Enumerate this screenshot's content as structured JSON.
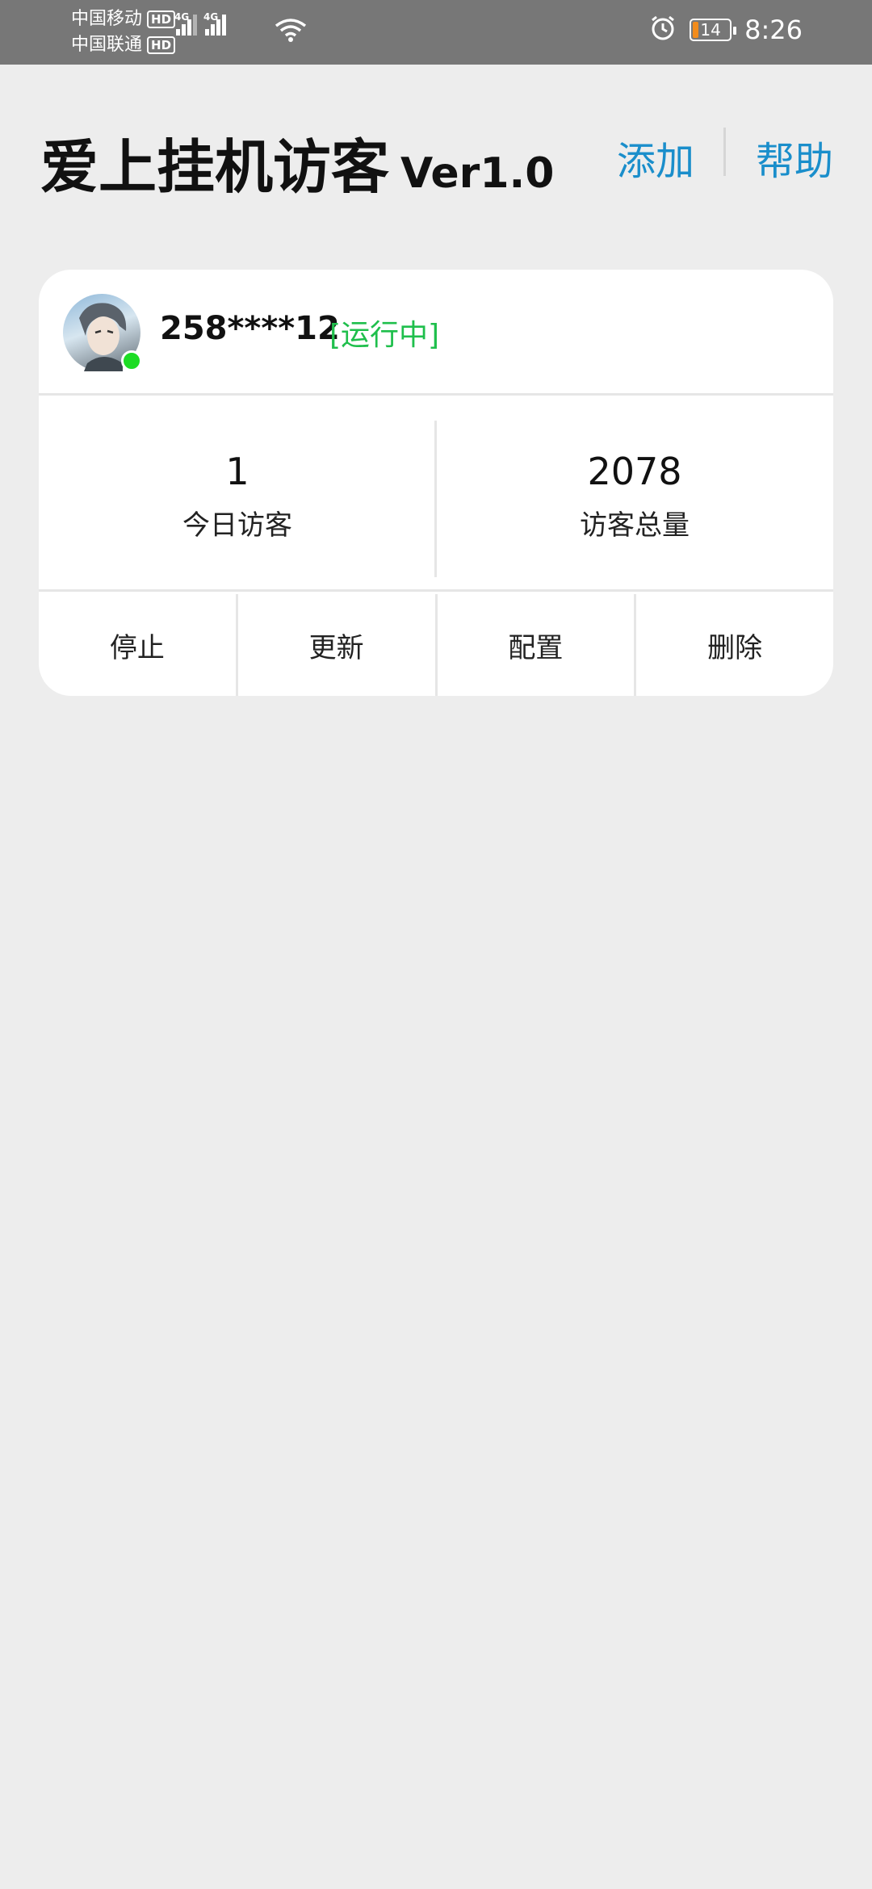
{
  "status_bar": {
    "carrier1": "中国移动",
    "carrier2": "中国联通",
    "hd_badge": "HD",
    "network1": "4G",
    "network2": "4G",
    "battery_percent": "14",
    "time": "8:26",
    "icons": [
      "signal-icon",
      "wifi-icon",
      "alarm-icon",
      "battery-icon"
    ]
  },
  "header": {
    "title": "爱上挂机访客",
    "version": "Ver1.0",
    "add_label": "添加",
    "help_label": "帮助"
  },
  "card": {
    "account": "258****12",
    "status": "[运行中]",
    "status_color": "#1fbf4c",
    "stats": [
      {
        "value": "1",
        "label": "今日访客"
      },
      {
        "value": "2078",
        "label": "访客总量"
      }
    ],
    "actions": [
      {
        "label": "停止"
      },
      {
        "label": "更新"
      },
      {
        "label": "配置"
      },
      {
        "label": "删除"
      }
    ]
  },
  "colors": {
    "accent": "#1a8ecb",
    "background": "#ededed",
    "online": "#1ddc24"
  }
}
